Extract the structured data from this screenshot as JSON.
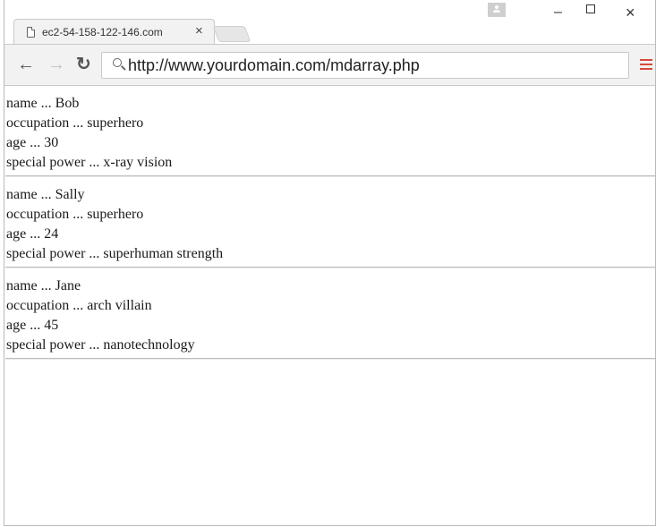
{
  "browser": {
    "tab_title": "ec2-54-158-122-146.com",
    "tab_close": "×",
    "url": "http://www.yourdomain.com/mdarray.php",
    "controls": {
      "minimize": "–",
      "close": "×"
    },
    "colors": {
      "menu": "#d94a3c",
      "toolbar": "#f2f2f2"
    }
  },
  "records": [
    {
      "name": "name ... Bob",
      "occupation": "occupation ... superhero",
      "age": "age ... 30",
      "power": "special power ... x-ray vision"
    },
    {
      "name": "name ... Sally",
      "occupation": "occupation ... superhero",
      "age": "age ... 24",
      "power": "special power ... superhuman strength"
    },
    {
      "name": "name ... Jane",
      "occupation": "occupation ... arch villain",
      "age": "age ... 45",
      "power": "special power ... nanotechnology"
    }
  ]
}
